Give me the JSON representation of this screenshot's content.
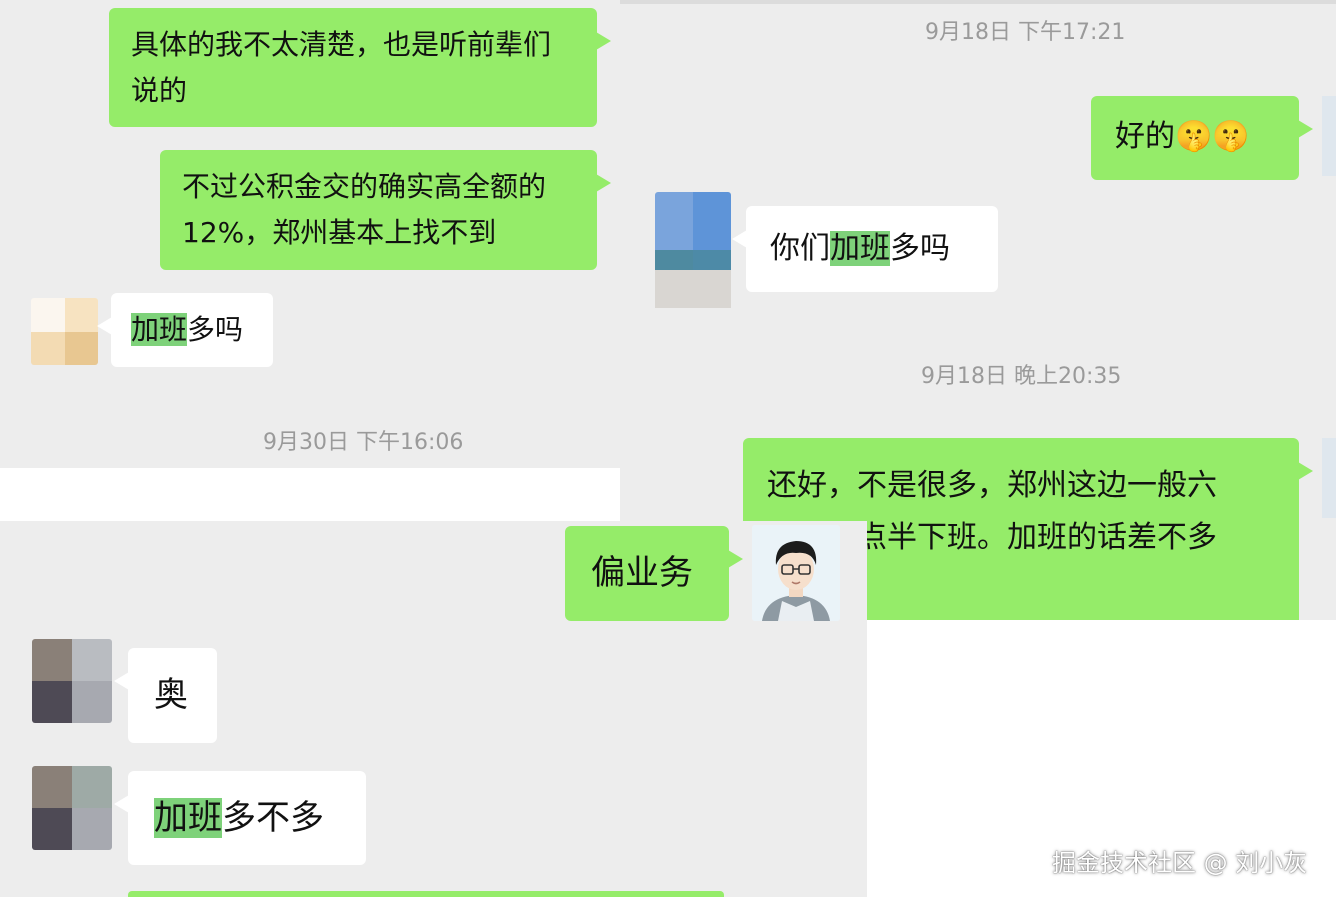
{
  "screenshot_a": {
    "messages": {
      "m1_line1": "具体的我不太清楚，也是听前辈们",
      "m1_line2": "说的",
      "m2_line1": "不过公积金交的确实高全额的",
      "m2_line2": "12%，郑州基本上找不到",
      "m3_highlight": "加班",
      "m3_rest": "多吗"
    },
    "timestamp": "9月30日 下午16:06"
  },
  "screenshot_b": {
    "timestamp_1": "9月18日 下午17:21",
    "msg_ok": "好的",
    "msg_ok_emoji": "🤫🤫",
    "msg_q_prefix": "你们",
    "msg_q_highlight": "加班",
    "msg_q_rest": "多吗",
    "timestamp_2": "9月18日 晚上20:35",
    "msg_reply_line1": "还好，不是很多，郑州这边一般六",
    "msg_reply_line2": "点到六点半下班。加班的话差不多"
  },
  "screenshot_c": {
    "msg_biz": "偏业务",
    "msg_ao": "奥",
    "msg_q_highlight": "加班",
    "msg_q_rest": "多不多"
  },
  "watermark": "掘金技术社区 @ 刘小灰",
  "colors": {
    "panel_bg": "#ededed",
    "green_bubble": "#95ec69",
    "white_bubble": "#ffffff",
    "highlight": "#7ed27a",
    "timestamp": "#9a9a9a"
  }
}
